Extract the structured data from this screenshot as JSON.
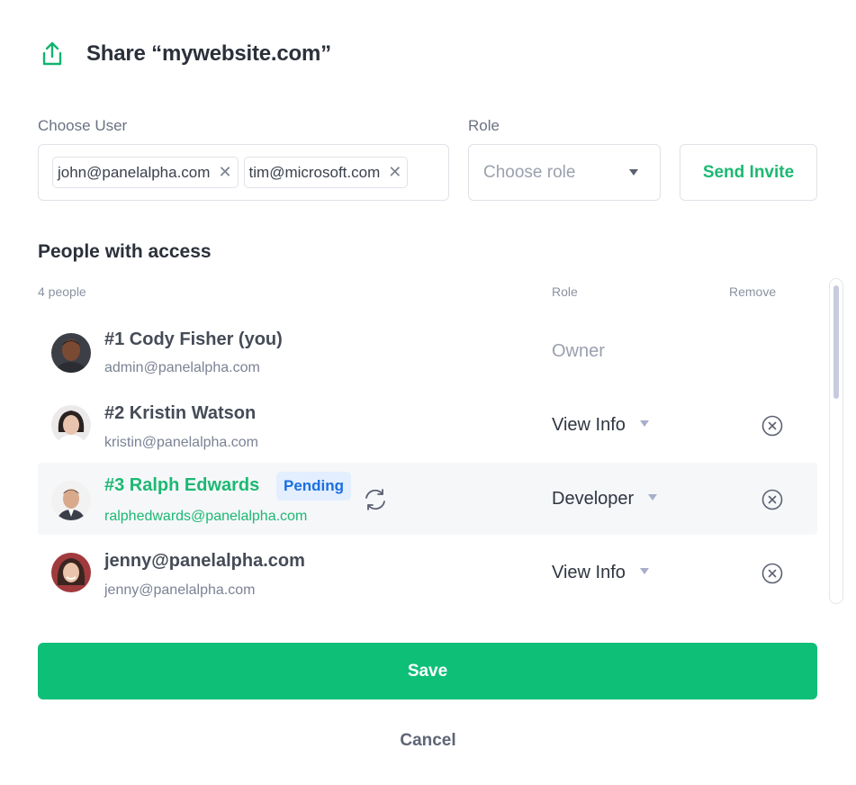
{
  "dialog": {
    "title": "Share “mywebsite.com”",
    "icon": "share-upload-icon",
    "accent_color": "#0ebf78"
  },
  "invite": {
    "user_label": "Choose User",
    "chips": [
      {
        "email": "john@panelalpha.com",
        "remove_symbol": "✕"
      },
      {
        "email": "tim@microsoft.com",
        "remove_symbol": "✕"
      }
    ],
    "role_label": "Role",
    "role_placeholder": "Choose role",
    "send_label": "Send Invite"
  },
  "access": {
    "title": "People with access",
    "count": "4 people",
    "role_header": "Role",
    "remove_header": "Remove",
    "people": [
      {
        "name": "#1 Cody Fisher (you)",
        "email": "admin@panelalpha.com",
        "role": "Owner"
      },
      {
        "name": "#2 Kristin Watson",
        "email": "kristin@panelalpha.com",
        "role": "View Info"
      },
      {
        "name": "#3 Ralph Edwards",
        "email": "ralphedwards@panelalpha.com",
        "role": "Developer",
        "badge": "Pending"
      },
      {
        "name": "jenny@panelalpha.com",
        "email": "jenny@panelalpha.com",
        "role": "View Info"
      }
    ]
  },
  "footer": {
    "save_label": "Save",
    "cancel_label": "Cancel"
  }
}
